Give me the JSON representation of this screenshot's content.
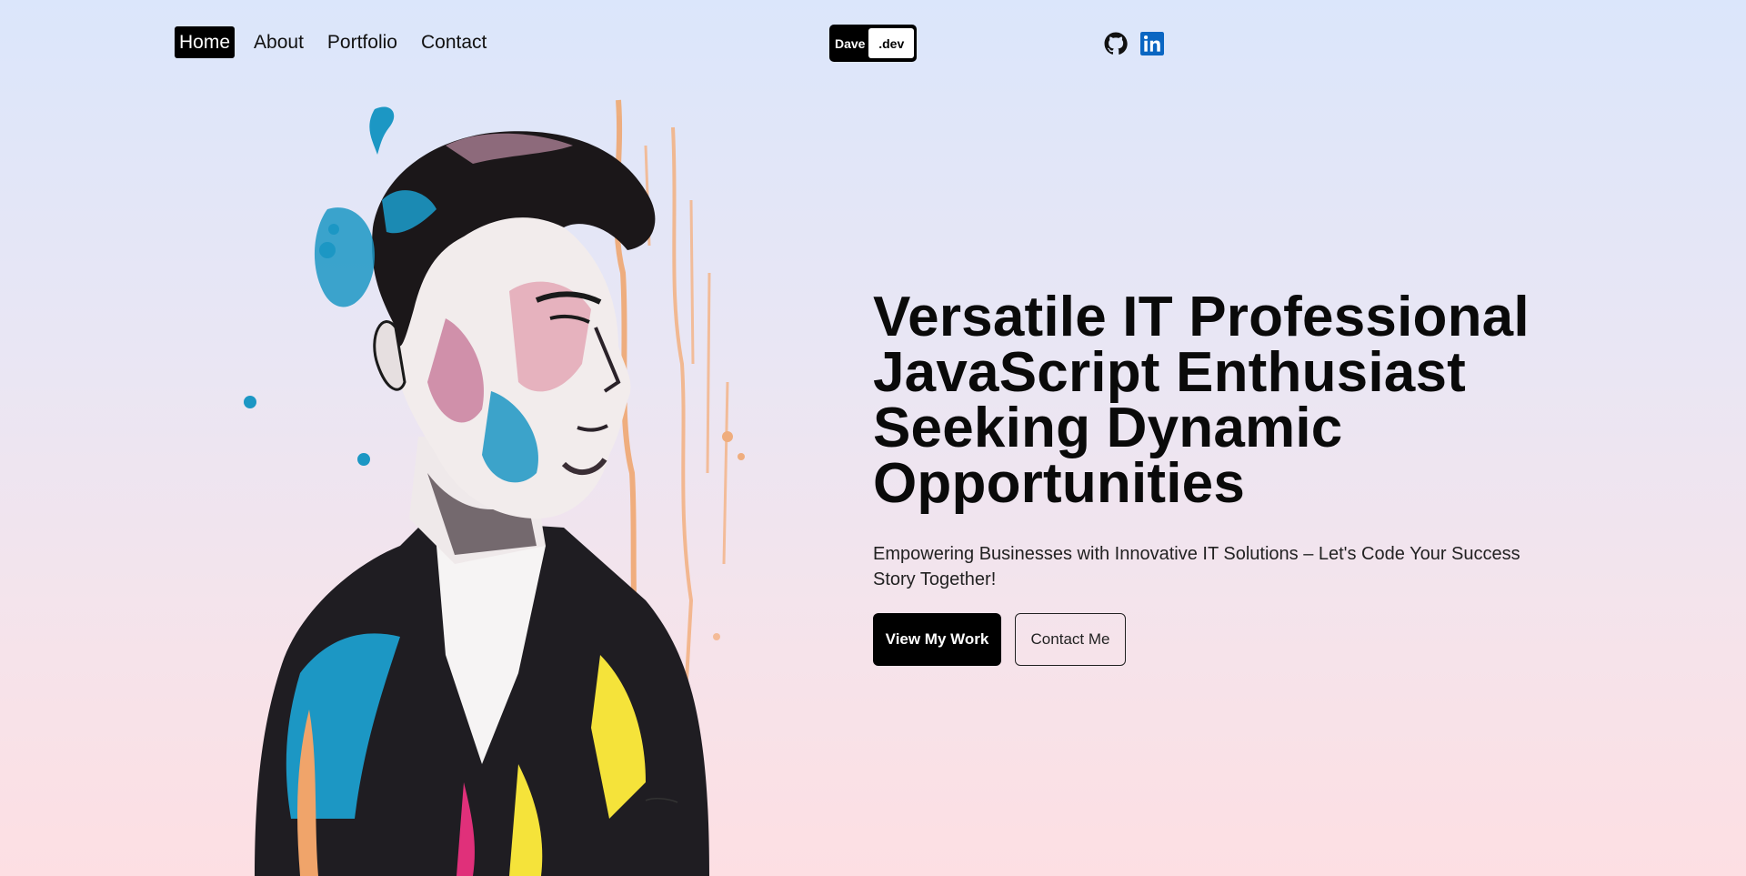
{
  "nav": {
    "links": [
      "Home",
      "About",
      "Portfolio",
      "Contact"
    ],
    "active": "Home"
  },
  "logo": {
    "left": "Dave",
    "right": ".dev"
  },
  "socials": [
    {
      "icon": "github-icon"
    },
    {
      "icon": "linkedin-icon",
      "color": "#0a66c2"
    }
  ],
  "hero": {
    "title_lines": [
      "Versatile IT Professional",
      "JavaScript Enthusiast",
      "Seeking Dynamic",
      "Opportunities"
    ],
    "subtitle": "Empowering Businesses with Innovative IT Solutions – Let's Code Your Success Story Together!",
    "primary_button": "View My Work",
    "secondary_button": "Contact Me"
  },
  "colors": {
    "background_top": "#dbe6fb",
    "background_bottom": "#fddfe3",
    "accent": "#000000",
    "linkedin": "#0a66c2"
  }
}
